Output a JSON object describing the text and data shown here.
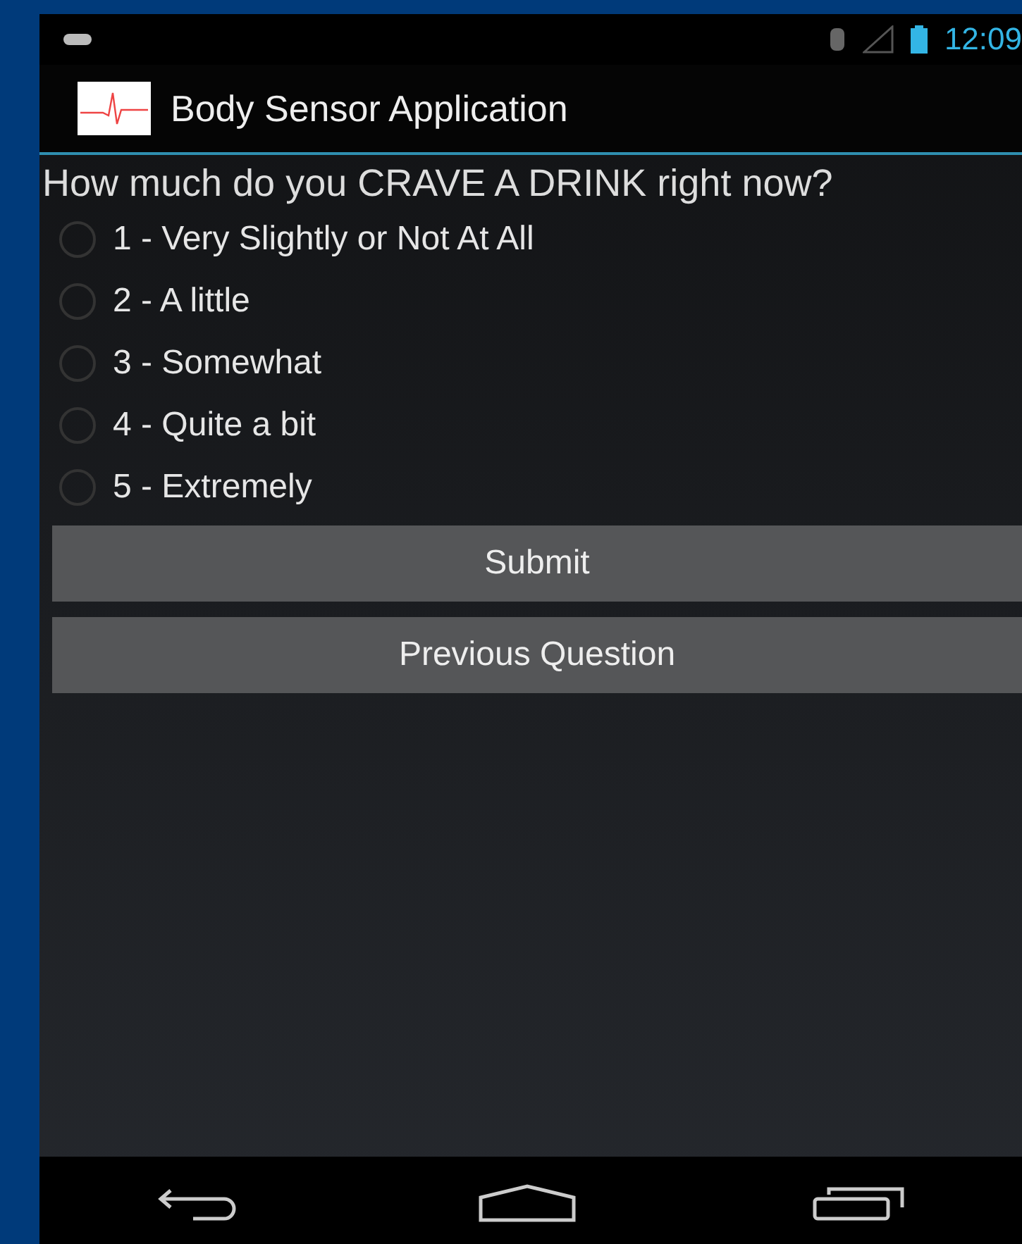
{
  "status_bar": {
    "time": "12:09"
  },
  "action_bar": {
    "title": "Body Sensor Application"
  },
  "question": "How much do you CRAVE A DRINK right now?",
  "options": [
    {
      "label": "1 - Very Slightly or Not At All",
      "selected": false
    },
    {
      "label": "2 - A little",
      "selected": false
    },
    {
      "label": "3 - Somewhat",
      "selected": false
    },
    {
      "label": "4 - Quite a bit",
      "selected": false
    },
    {
      "label": "5 - Extremely",
      "selected": false
    }
  ],
  "buttons": [
    "Submit",
    "Previous Question"
  ]
}
